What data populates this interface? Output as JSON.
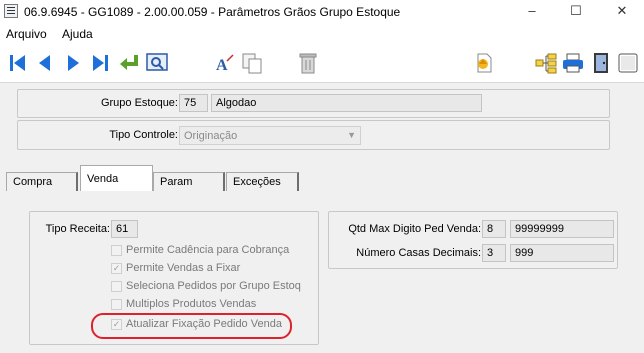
{
  "window": {
    "title": "06.9.6945 - GG1089 - 2.00.00.059 - Parâmetros Grãos Grupo Estoque",
    "minimize": "–",
    "maximize": "☐",
    "close": "✕"
  },
  "menu": {
    "items": [
      "Arquivo",
      "Ajuda"
    ]
  },
  "toolbar": {
    "buttons": [
      "first-record-icon",
      "previous-record-icon",
      "next-record-icon",
      "last-record-icon",
      "return-icon",
      "search-icon",
      "text-format-icon",
      "copy-icon",
      "trash-icon",
      "export-icon",
      "hierarchy-icon",
      "print-icon",
      "exit-door-icon",
      "help-icon"
    ]
  },
  "header": {
    "grupo_estoque_label": "Grupo Estoque:",
    "grupo_estoque_code": "75",
    "grupo_estoque_name": "Algodao",
    "tipo_controle_label": "Tipo Controle:",
    "tipo_controle_value": "Originação"
  },
  "tabs": [
    {
      "label": "Compra"
    },
    {
      "label": "Venda"
    },
    {
      "label": "Param"
    },
    {
      "label": "Exceções"
    }
  ],
  "venda": {
    "tipo_receita_label": "Tipo Receita:",
    "tipo_receita_value": "61",
    "checkboxes": [
      {
        "label": "Permite Cadência para Cobrança",
        "checked": false
      },
      {
        "label": "Permite Vendas a Fixar",
        "checked": true
      },
      {
        "label": "Seleciona Pedidos por Grupo Estoq",
        "checked": false
      },
      {
        "label": "Multiplos Produtos Vendas",
        "checked": false
      },
      {
        "label": "Atualizar Fixação Pedido Venda",
        "checked": true
      }
    ],
    "qtd_max_label": "Qtd Max Digito Ped Venda:",
    "qtd_max_value": "8",
    "qtd_max_mask": "99999999",
    "casas_label": "Número Casas Decimais:",
    "casas_value": "3",
    "casas_mask": "999"
  },
  "colors": {
    "highlight": "#e0202a",
    "icon_blue": "#1e6fd9"
  }
}
